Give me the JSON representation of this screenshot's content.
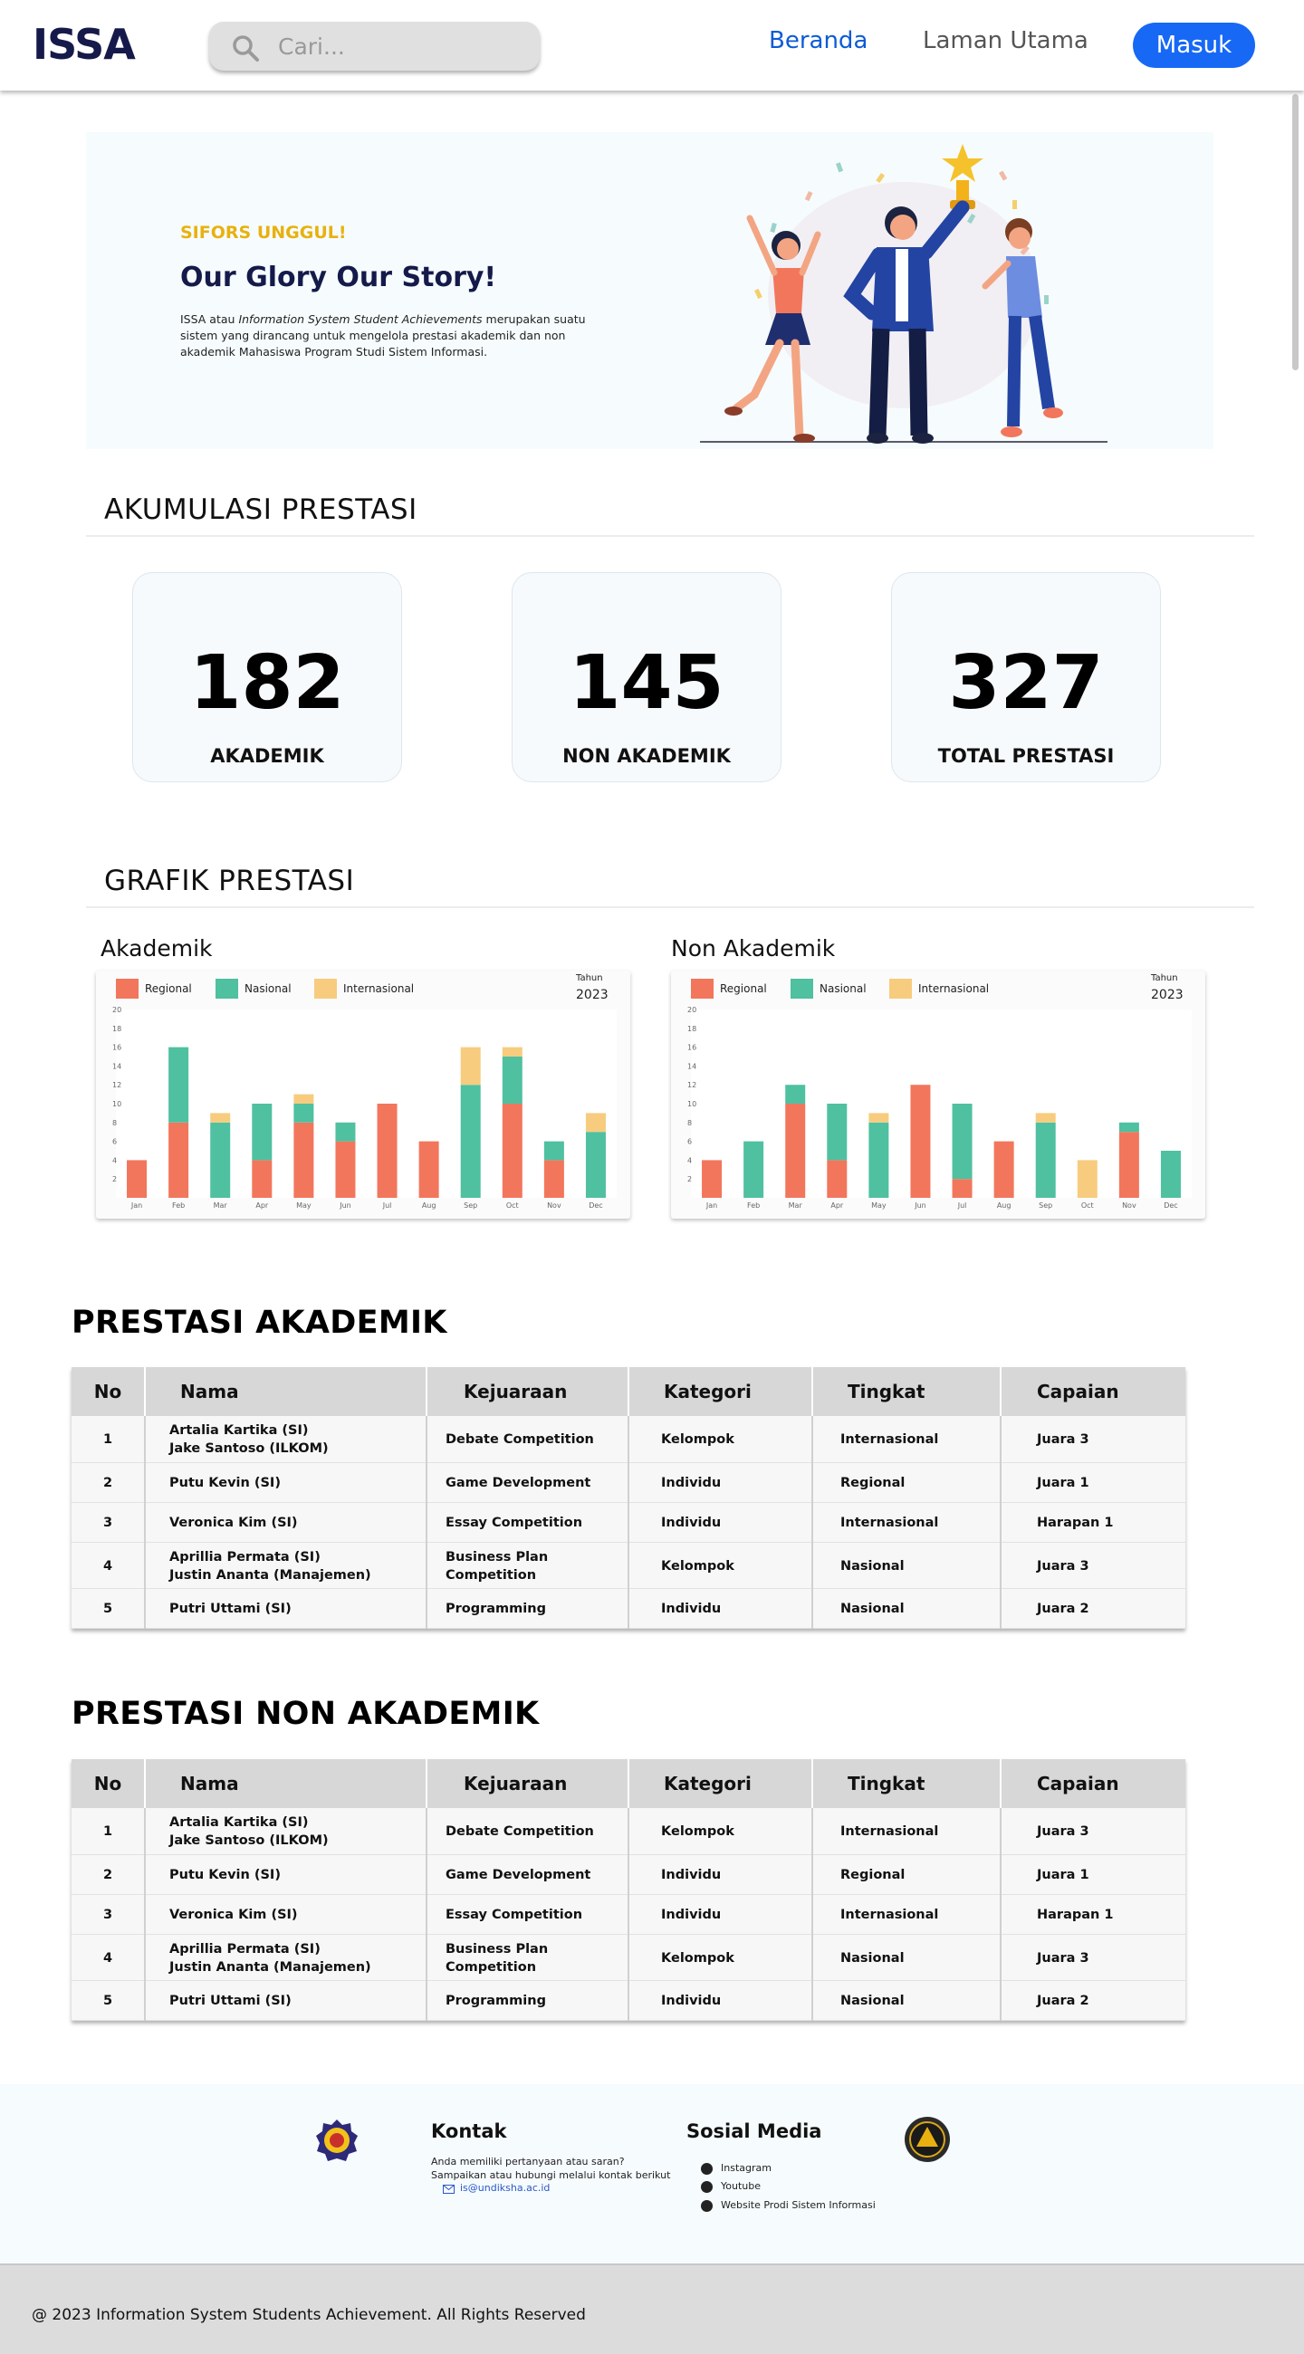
{
  "nav": {
    "logo": "ISSA",
    "search_placeholder": "Cari...",
    "links": [
      "Beranda",
      "Laman Utama"
    ],
    "login": "Masuk",
    "active_link": "Beranda"
  },
  "hero": {
    "eyebrow": "SIFORS UNGGUL!",
    "title": "Our Glory Our Story!",
    "desc_before": "ISSA atau ",
    "desc_italic": "Information System Student Achievements",
    "desc_after": " merupakan suatu sistem yang dirancang untuk mengelola prestasi akademik dan non akademik Mahasiswa Program Studi Sistem Informasi."
  },
  "accumulation": {
    "title": "AKUMULASI PRESTASI",
    "stats": [
      {
        "value": "182",
        "label": "AKADEMIK"
      },
      {
        "value": "145",
        "label": "NON AKADEMIK"
      },
      {
        "value": "327",
        "label": "TOTAL PRESTASI"
      }
    ]
  },
  "graph": {
    "title": "GRAFIK PRESTASI",
    "year_label": "Tahun",
    "year": "2023"
  },
  "colors": {
    "regional": "#f2765c",
    "nasional": "#4fc0a0",
    "internasional": "#f7cc7e",
    "primary": "#1768f5",
    "accent": "#e8b10f"
  },
  "chart_data": [
    {
      "title": "Akademik",
      "type": "bar",
      "stacked": true,
      "categories": [
        "Jan",
        "Feb",
        "Mar",
        "Apr",
        "May",
        "Jun",
        "Jul",
        "Aug",
        "Sep",
        "Oct",
        "Nov",
        "Dec"
      ],
      "series": [
        {
          "name": "Regional",
          "values": [
            4,
            8,
            0,
            4,
            8,
            6,
            10,
            6,
            0,
            10,
            4,
            0
          ]
        },
        {
          "name": "Nasional",
          "values": [
            0,
            8,
            8,
            6,
            2,
            2,
            0,
            0,
            12,
            5,
            2,
            7
          ]
        },
        {
          "name": "Internasional",
          "values": [
            0,
            0,
            1,
            0,
            1,
            0,
            0,
            0,
            4,
            1,
            0,
            2
          ]
        }
      ],
      "ylim": [
        0,
        20
      ],
      "yticks": [
        2,
        4,
        6,
        8,
        10,
        12,
        14,
        16,
        18,
        20
      ],
      "legend": "top-left"
    },
    {
      "title": "Non Akademik",
      "type": "bar",
      "stacked": true,
      "categories": [
        "Jan",
        "Feb",
        "Mar",
        "Apr",
        "May",
        "Jun",
        "Jul",
        "Aug",
        "Sep",
        "Oct",
        "Nov",
        "Dec"
      ],
      "series": [
        {
          "name": "Regional",
          "values": [
            4,
            0,
            10,
            4,
            0,
            12,
            2,
            6,
            0,
            0,
            7,
            0
          ]
        },
        {
          "name": "Nasional",
          "values": [
            0,
            6,
            2,
            6,
            8,
            0,
            8,
            0,
            8,
            0,
            1,
            5
          ]
        },
        {
          "name": "Internasional",
          "values": [
            0,
            0,
            0,
            0,
            1,
            0,
            0,
            0,
            1,
            4,
            0,
            0
          ]
        }
      ],
      "ylim": [
        0,
        20
      ],
      "yticks": [
        2,
        4,
        6,
        8,
        10,
        12,
        14,
        16,
        18,
        20
      ],
      "legend": "top-left"
    }
  ],
  "tables": [
    {
      "title": "PRESTASI AKADEMIK",
      "headers": [
        "No",
        "Nama",
        "Kejuaraan",
        "Kategori",
        "Tingkat",
        "Capaian"
      ],
      "rows": [
        [
          "1",
          "Artalia Kartika (SI)\nJake Santoso (ILKOM)",
          "Debate Competition",
          "Kelompok",
          "Internasional",
          "Juara 3"
        ],
        [
          "2",
          "Putu Kevin (SI)",
          "Game Development",
          "Individu",
          "Regional",
          "Juara 1"
        ],
        [
          "3",
          "Veronica Kim (SI)",
          "Essay Competition",
          "Individu",
          "Internasional",
          "Harapan 1"
        ],
        [
          "4",
          "Aprillia Permata (SI)\nJustin Ananta (Manajemen)",
          "Business Plan Competition",
          "Kelompok",
          "Nasional",
          "Juara 3"
        ],
        [
          "5",
          "Putri Uttami (SI)",
          "Programming",
          "Individu",
          "Nasional",
          "Juara 2"
        ]
      ]
    },
    {
      "title": "PRESTASI NON AKADEMIK",
      "headers": [
        "No",
        "Nama",
        "Kejuaraan",
        "Kategori",
        "Tingkat",
        "Capaian"
      ],
      "rows": [
        [
          "1",
          "Artalia Kartika (SI)\nJake Santoso (ILKOM)",
          "Debate Competition",
          "Kelompok",
          "Internasional",
          "Juara 3"
        ],
        [
          "2",
          "Putu Kevin (SI)",
          "Game Development",
          "Individu",
          "Regional",
          "Juara 1"
        ],
        [
          "3",
          "Veronica Kim (SI)",
          "Essay Competition",
          "Individu",
          "Internasional",
          "Harapan 1"
        ],
        [
          "4",
          "Aprillia Permata (SI)\nJustin Ananta (Manajemen)",
          "Business Plan Competition",
          "Kelompok",
          "Nasional",
          "Juara 3"
        ],
        [
          "5",
          "Putri Uttami (SI)",
          "Programming",
          "Individu",
          "Nasional",
          "Juara 2"
        ]
      ]
    }
  ],
  "footer": {
    "contact_title": "Kontak",
    "contact_line1": "Anda memiliki pertanyaan atau saran?",
    "contact_line2": "Sampaikan atau hubungi melalui kontak berikut",
    "email": "is@undiksha.ac.id",
    "social_title": "Sosial Media",
    "socials": [
      {
        "label": "Instagram",
        "icon": "instagram-icon"
      },
      {
        "label": "Youtube",
        "icon": "youtube-icon"
      },
      {
        "label": "Website Prodi Sistem Informasi",
        "icon": "globe-icon"
      }
    ],
    "copyright": "@ 2023 Information System Students Achievement. All Rights Reserved"
  }
}
